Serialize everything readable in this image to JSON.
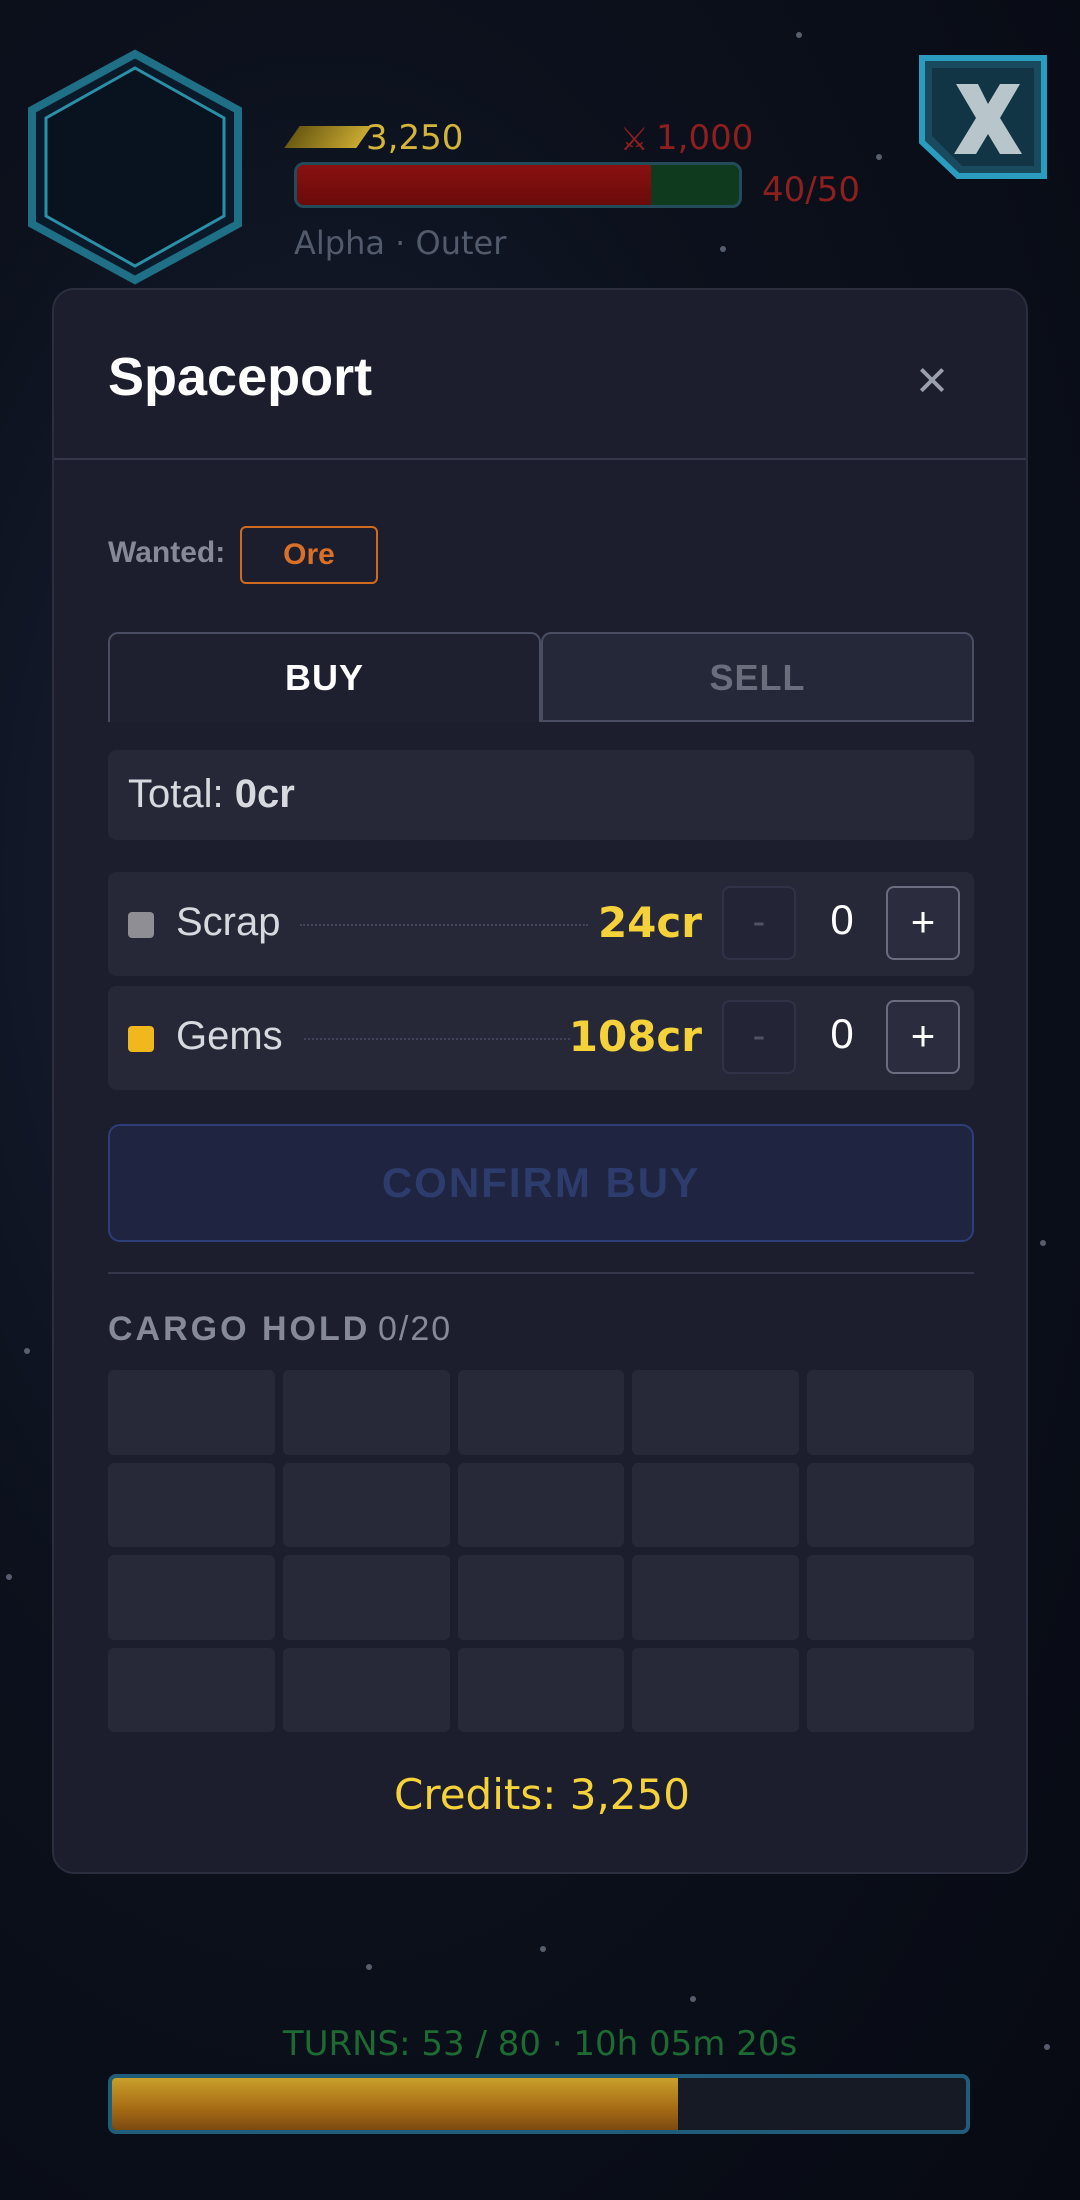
{
  "hud": {
    "credits": "3,250",
    "pirate_bounty": "1,000",
    "hull_text": "40/50",
    "hull_fraction": 0.8,
    "location": "Alpha · Outer",
    "portrait_icon": "hexagon-frame-icon",
    "exit_icon": "x-logo-icon"
  },
  "modal": {
    "title": "Spaceport",
    "close_glyph": "×",
    "wanted_label": "Wanted:",
    "wanted_item": "Ore",
    "tabs": {
      "buy": "BUY",
      "sell": "SELL",
      "active": "buy"
    },
    "total_label": "Total:",
    "total_value": "0cr",
    "items": [
      {
        "name": "Scrap",
        "price": "24cr",
        "qty": "0",
        "color": "#8e8e94"
      },
      {
        "name": "Gems",
        "price": "108cr",
        "qty": "0",
        "color": "#f0b81c"
      }
    ],
    "stepper": {
      "minus": "-",
      "plus": "+"
    },
    "confirm_label": "CONFIRM BUY",
    "cargo_title": "CARGO HOLD",
    "cargo_count": "0/20",
    "cargo_slots": 20,
    "credits_label": "Credits: 3,250"
  },
  "turns": {
    "text": "TURNS: 53 / 80  ·  10h 05m 20s",
    "fraction": 0.6625
  },
  "colors": {
    "accent_gold": "#f5d23a",
    "wanted_orange": "#d06a1e",
    "modal_bg": "#1c1e2d"
  }
}
